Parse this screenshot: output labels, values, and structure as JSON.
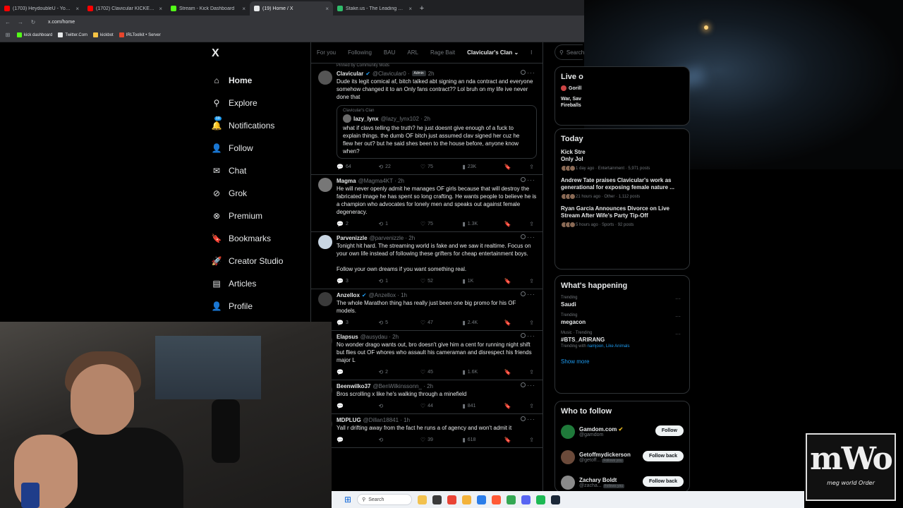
{
  "browser": {
    "tabs": [
      {
        "label": "(1703) HeydoubleU - YouTube",
        "color": "#ff0000",
        "active": false
      },
      {
        "label": "(1702) Clavicular KICKED OUT",
        "color": "#ff0000",
        "active": false
      },
      {
        "label": "Stream - Kick Dashboard",
        "color": "#53fc18",
        "active": false
      },
      {
        "label": "(19) Home / X",
        "color": "#e7e9ea",
        "active": true
      },
      {
        "label": "Stake.us - The Leading Social C",
        "color": "#2fbb6a",
        "active": false
      }
    ],
    "url": "x.com/home",
    "bookmarks": [
      {
        "label": "kick dashboard",
        "color": "#53fc18"
      },
      {
        "label": "Twitter.Com",
        "color": "#e7e9ea"
      },
      {
        "label": "kickbot",
        "color": "#f6c344"
      },
      {
        "label": "IRLToolkit • Server",
        "color": "#e8452c"
      }
    ]
  },
  "nav": {
    "logo": "X",
    "items": [
      {
        "label": "Home",
        "icon": "home-icon",
        "glyph": "⌂"
      },
      {
        "label": "Explore",
        "icon": "search-icon",
        "glyph": "⚲"
      },
      {
        "label": "Notifications",
        "icon": "bell-icon",
        "glyph": "🔔",
        "badge": "19"
      },
      {
        "label": "Follow",
        "icon": "person-add-icon",
        "glyph": "👤"
      },
      {
        "label": "Chat",
        "icon": "mail-icon",
        "glyph": "✉"
      },
      {
        "label": "Grok",
        "icon": "grok-icon",
        "glyph": "⊘"
      },
      {
        "label": "Premium",
        "icon": "x-premium-icon",
        "glyph": "⊗"
      },
      {
        "label": "Bookmarks",
        "icon": "bookmark-icon",
        "glyph": "🔖"
      },
      {
        "label": "Creator Studio",
        "icon": "rocket-icon",
        "glyph": "🚀"
      },
      {
        "label": "Articles",
        "icon": "article-icon",
        "glyph": "▤"
      },
      {
        "label": "Profile",
        "icon": "profile-icon",
        "glyph": "👤"
      }
    ]
  },
  "timeline": {
    "tabs": [
      "For you",
      "Following",
      "BAU",
      "ARL",
      "Rage Bait",
      "Clavicular's Clan ⌄",
      "I"
    ],
    "pinned_note": "Pinned by Community Mods",
    "posts": [
      {
        "name": "Clavicular",
        "verified": true,
        "handle": "@Clavicular0 ·",
        "badge": "Admin",
        "time": "2h",
        "text": "Dude its legit comical af, bitch talked abt signing an nda contract and everyone somehow changed it to an Only fans contract?? Lol bruh on my life ive never done that",
        "quote": {
          "community": "Clavicular's Clan",
          "name": "lazy_lynx",
          "handle": "@lazy_lynx102 · 2h",
          "text": "what if clavs telling the truth? he just doesnt give enough of a fuck to explain things. the dumb OF bitch just assumed clav signed her cuz he flew her out? but he said shes been to the house before, anyone know when?"
        },
        "replies": "64",
        "reposts": "22",
        "likes": "75",
        "views": "23K",
        "avatar_color": "#555555"
      },
      {
        "name": "Magma",
        "verified": false,
        "handle": "@Magma4KT · 2h",
        "badge": "",
        "time": "",
        "text": "He will never openly admit he manages OF girls because that will destroy the fabricated image he has spent so long crafting. He wants people to believe he is a champion who advocates for lonely men and speaks out against female degeneracy.",
        "replies": "2",
        "reposts": "1",
        "likes": "75",
        "views": "1.3K",
        "avatar_color": "#777777"
      },
      {
        "name": "Parvenizzle",
        "verified": false,
        "handle": "@parvenizzle · 2h",
        "badge": "",
        "time": "",
        "text": "Tonight hit hard. The streaming world is fake and we saw it realtime. Focus on your own life instead of following these grifters for cheap entertainment boys.\n\nFollow your own dreams if you want something real.",
        "replies": "3",
        "reposts": "1",
        "likes": "52",
        "views": "1K",
        "avatar_color": "#c9d6e3"
      },
      {
        "name": "Anzellox",
        "verified": true,
        "handle": "@Anzellox · 1h",
        "badge": "",
        "time": "",
        "text": "The whole Marathon thing has really just been one big promo for his OF models.",
        "replies": "3",
        "reposts": "5",
        "likes": "47",
        "views": "2.4K",
        "avatar_color": "#3a3a3a"
      },
      {
        "name": "Elapsus",
        "verified": false,
        "handle": "@ausydau · 2h",
        "badge": "",
        "time": "",
        "text": "No wonder drago wants out, bro doesn't give him a cent for running night shift but flies out OF whores who assault his cameraman and disrespect his friends major L",
        "replies": "",
        "reposts": "2",
        "likes": "45",
        "views": "1.6K",
        "avatar_color": "#2a2a2a"
      },
      {
        "name": "Beenwilko37",
        "verified": false,
        "handle": "@BenWilkinssonn_ · 2h",
        "badge": "",
        "time": "",
        "text": "Bros scrolling x like he's walking through a minefield",
        "replies": "",
        "reposts": "",
        "likes": "44",
        "views": "841",
        "avatar_color": "#2a2a2a"
      },
      {
        "name": "MDPLUG",
        "verified": false,
        "handle": "@Dillan18841 · 1h",
        "badge": "",
        "time": "",
        "text": "Yall r drifting away from the fact he runs a of agency and won't admit it",
        "replies": "",
        "reposts": "",
        "likes": "39",
        "views": "618",
        "avatar_color": "#2a2a2a"
      }
    ]
  },
  "right": {
    "search_placeholder": "Search",
    "live_title": "Live o",
    "live_host": "Gorill",
    "live_text": "War, Sav\nFireballs",
    "today_title": "Today",
    "today": [
      {
        "title": "Kick Stre\nOnly Jol",
        "meta": "1 day ago · Entertainment · 5,971 posts"
      },
      {
        "title": "Andrew Tate praises Clavicular's work as generational for exposing female nature ...",
        "meta": "21 hours ago · Other · 1,112 posts"
      },
      {
        "title": "Ryan Garcia Announces Divorce on Live Stream After Wife's Party Tip-Off",
        "meta": "5 hours ago · Sports · 92 posts"
      }
    ],
    "happening_title": "What's happening",
    "trends": [
      {
        "meta": "Trending",
        "name": "Saudi",
        "with": "",
        "links": ""
      },
      {
        "meta": "Trending",
        "name": "megacon",
        "with": "",
        "links": ""
      },
      {
        "meta": "Music · Trending",
        "name": "#BTS_ARIRANG",
        "with": "Trending with",
        "links": "namjoon, Like Animals"
      }
    ],
    "show_more": "Show more",
    "wtf_title": "Who to follow",
    "follows": [
      {
        "name": "Gamdom.com",
        "handle": "@gamdom",
        "verified": true,
        "follows_you": "",
        "button": "Follow",
        "color": "#1f7a3a"
      },
      {
        "name": "Getoffmydickerson",
        "handle": "@getoff...",
        "verified": false,
        "follows_you": "Follows you",
        "button": "Follow back",
        "color": "#6b4a3a"
      },
      {
        "name": "Zachary Boldt",
        "handle": "@zacha...",
        "verified": false,
        "follows_you": "Follows you",
        "button": "Follow back",
        "color": "#8a8a8a"
      }
    ]
  },
  "taskbar": {
    "search": "Search",
    "icons": [
      "#f2c14e",
      "#3a3a3a",
      "#e94335",
      "#f3b23a",
      "#2b7de9",
      "#ff5a36",
      "#34a853",
      "#5865f2",
      "#1db954",
      "#1b2838"
    ]
  },
  "logo": {
    "big": "mWo",
    "small": "meg world Order"
  }
}
